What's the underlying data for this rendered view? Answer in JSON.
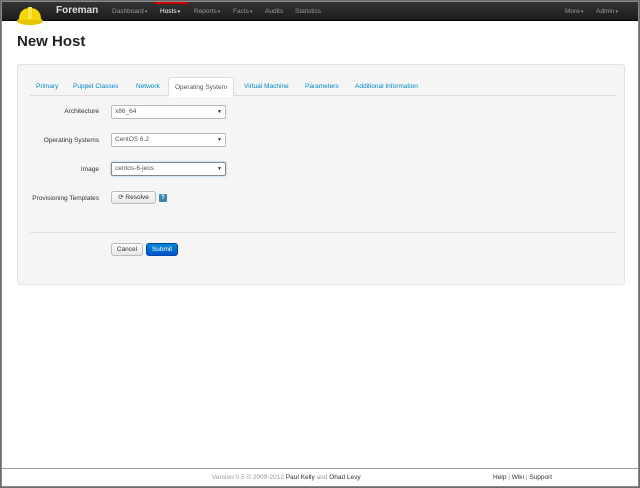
{
  "navbar": {
    "brand": "Foreman",
    "items": [
      {
        "label": "Dashboard"
      },
      {
        "label": "Hosts"
      },
      {
        "label": "Reports"
      },
      {
        "label": "Facts"
      },
      {
        "label": "Audits"
      },
      {
        "label": "Statistics"
      }
    ],
    "right_items": [
      {
        "label": "More"
      },
      {
        "label": "Admin"
      }
    ],
    "active_item": "Hosts"
  },
  "page": {
    "title": "New Host"
  },
  "tabs": [
    {
      "label": "Primary"
    },
    {
      "label": "Puppet Classes"
    },
    {
      "label": "Network"
    },
    {
      "label": "Operating System"
    },
    {
      "label": "Virtual Machine"
    },
    {
      "label": "Parameters"
    },
    {
      "label": "Additional Information"
    }
  ],
  "active_tab": "Operating System",
  "form": {
    "architecture": {
      "label": "Architecture",
      "value": "x86_64"
    },
    "operating_system": {
      "label": "Operating Systems",
      "value": "CentOS 6.2"
    },
    "image": {
      "label": "Image",
      "value": "centos-6-jeos"
    },
    "provisioning": {
      "label": "Provisioning Templates",
      "resolve_label": "Resolve",
      "help": "?"
    }
  },
  "actions": {
    "cancel": "Cancel",
    "submit": "Submit"
  },
  "footer": {
    "version": "Version 0.5 © 2009-2012",
    "author1": "Paul Kelly",
    "and": "and",
    "author2": "Ohad Levy",
    "help": "Help",
    "sep": "|",
    "wiki": "Wiki",
    "support": "Support"
  },
  "colors": {
    "navbar_bg": "#1c1c1c",
    "link": "#0088cc",
    "primary": "#0055cc",
    "panel_bg": "#f5f5f5"
  }
}
